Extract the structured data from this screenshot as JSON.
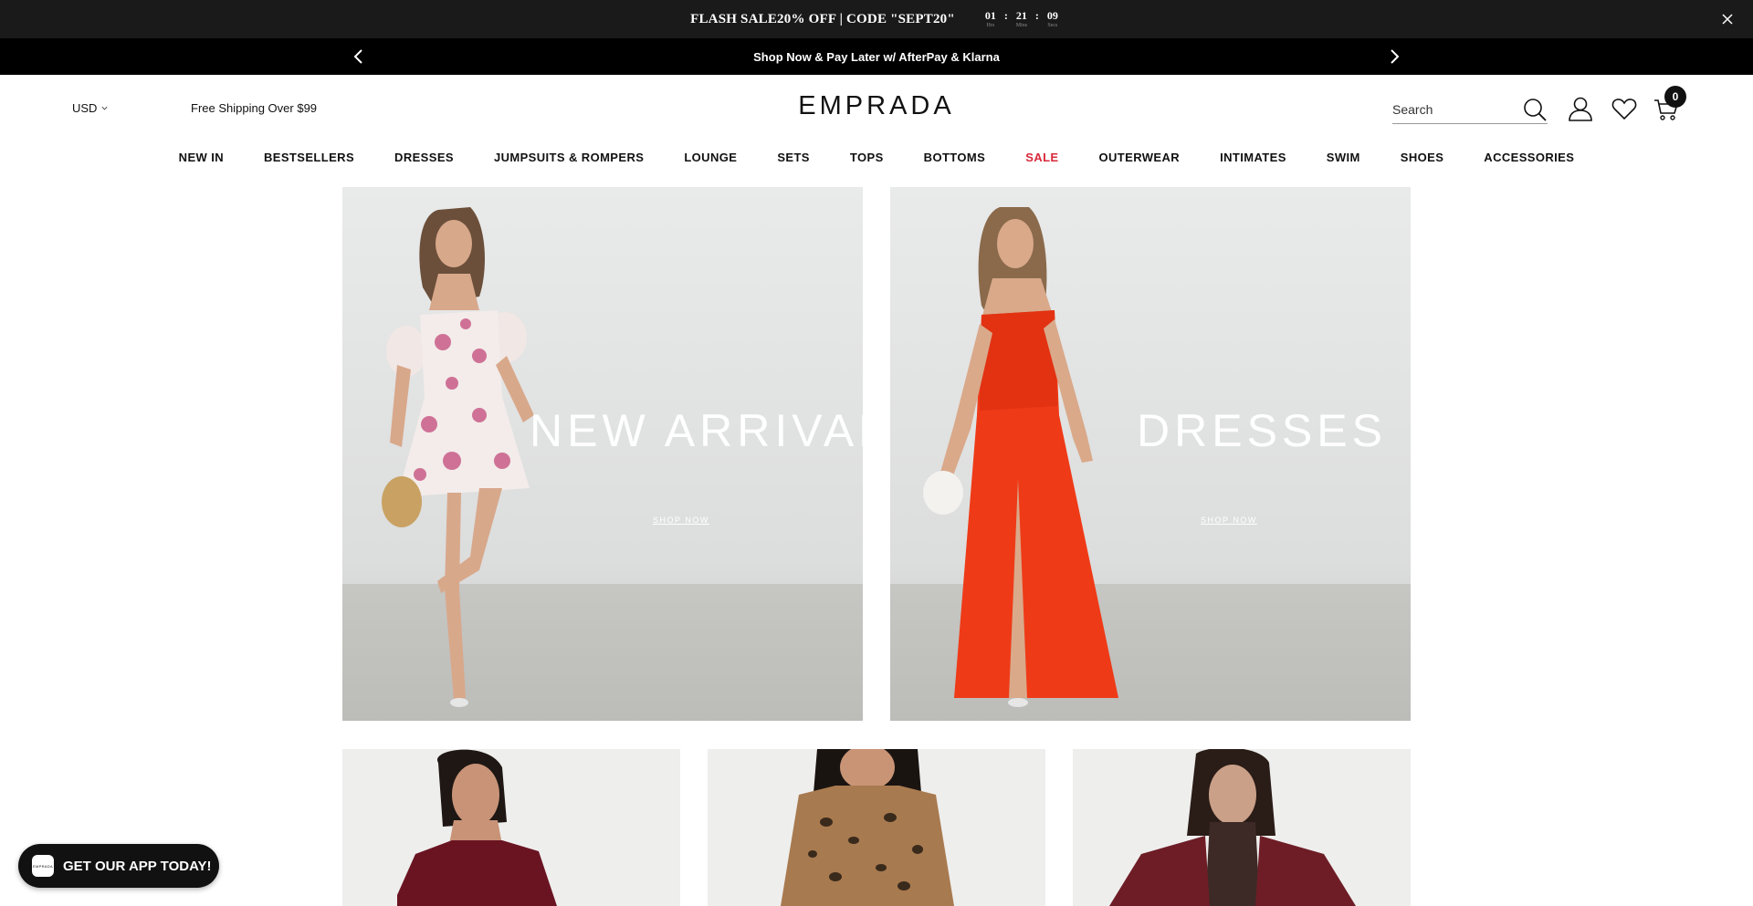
{
  "flash_bar": {
    "text": "FLASH SALE20% OFF | CODE \"SEPT20\"",
    "countdown": {
      "hours": "01",
      "hours_label": "Hrs",
      "mins": "21",
      "mins_label": "Mins",
      "secs": "09",
      "secs_label": "Secs",
      "separator": ":"
    },
    "close_icon": "close-icon"
  },
  "promo_bar": {
    "text": "Shop Now & Pay Later w/ AfterPay & Klarna",
    "prev_icon": "chevron-left-icon",
    "next_icon": "chevron-right-icon"
  },
  "header": {
    "currency": "USD",
    "free_shipping": "Free Shipping Over $99",
    "logo": "EMPRADA",
    "search_placeholder": "Search",
    "cart_count": "0"
  },
  "nav": {
    "items": [
      "NEW IN",
      "BESTSELLERS",
      "DRESSES",
      "JUMPSUITS & ROMPERS",
      "LOUNGE",
      "SETS",
      "TOPS",
      "BOTTOMS",
      "SALE",
      "OUTERWEAR",
      "INTIMATES",
      "SWIM",
      "SHOES",
      "ACCESSORIES"
    ],
    "sale_color": "#d9283b"
  },
  "banners": [
    {
      "title": "NEW ARRIVALS",
      "link": "SHOP NOW"
    },
    {
      "title": "DRESSES",
      "link": "SHOP NOW"
    }
  ],
  "app_prompt": {
    "label": "GET OUR APP TODAY!",
    "logo_text": "EMPRADA"
  },
  "colors": {
    "flash_bg": "#1a1a1a",
    "promo_bg": "#000000",
    "accent_sale": "#d9283b"
  }
}
